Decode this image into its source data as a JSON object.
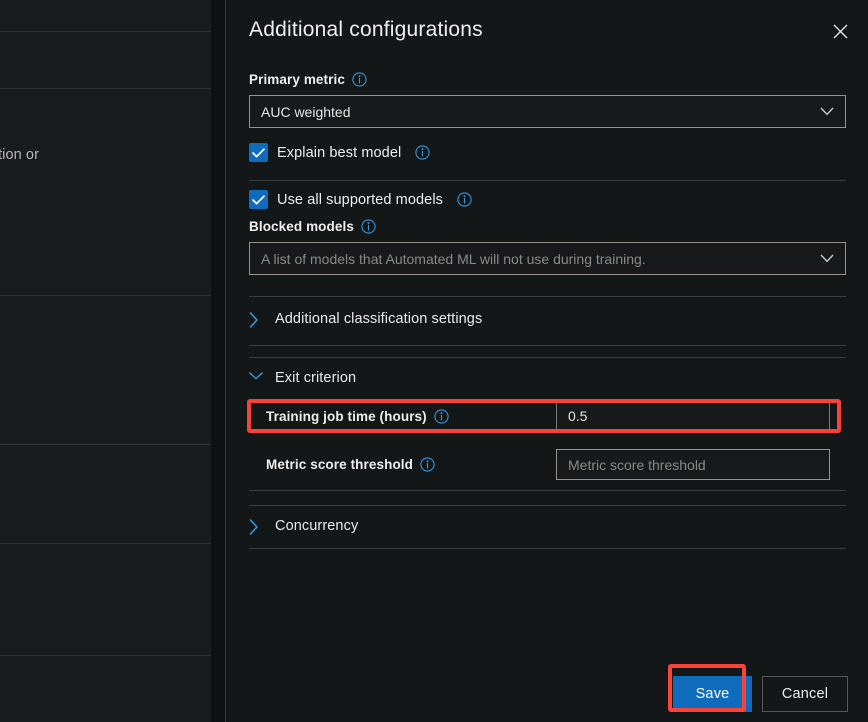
{
  "background": {
    "fragment_text": "tion or"
  },
  "panel": {
    "title": "Additional configurations",
    "close_icon": "close-icon"
  },
  "form": {
    "primary_metric": {
      "label": "Primary metric",
      "info_icon": "info-icon",
      "value": "AUC weighted",
      "caret_icon": "chevron-down-icon"
    },
    "explain_best_model": {
      "label": "Explain best model",
      "checked": true,
      "info_icon": "info-icon"
    },
    "use_all_supported_models": {
      "label": "Use all supported models",
      "checked": true,
      "info_icon": "info-icon"
    },
    "blocked_models": {
      "label": "Blocked models",
      "info_icon": "info-icon",
      "value": "",
      "placeholder": "A list of models that Automated ML will not use during training.",
      "caret_icon": "chevron-down-icon"
    },
    "additional_classification_settings": {
      "label": "Additional classification settings",
      "expanded": false,
      "chevron_icon": "chevron-right-icon"
    },
    "exit_criterion": {
      "label": "Exit criterion",
      "expanded": true,
      "chevron_icon": "chevron-down-icon"
    },
    "training_job_time": {
      "label": "Training job time (hours)",
      "info_icon": "info-icon",
      "value": "0.5",
      "placeholder": ""
    },
    "metric_score_threshold": {
      "label": "Metric score threshold",
      "info_icon": "info-icon",
      "value": "",
      "placeholder": "Metric score threshold"
    },
    "concurrency": {
      "label": "Concurrency",
      "expanded": false,
      "chevron_icon": "chevron-right-icon"
    }
  },
  "footer": {
    "save_label": "Save",
    "cancel_label": "Cancel"
  },
  "colors": {
    "accent_blue": "#0f6cbd",
    "highlight_red": "#f9423a",
    "panel_bg": "#141718",
    "input_border": "#9c9284",
    "divider": "#3b3e3f"
  }
}
